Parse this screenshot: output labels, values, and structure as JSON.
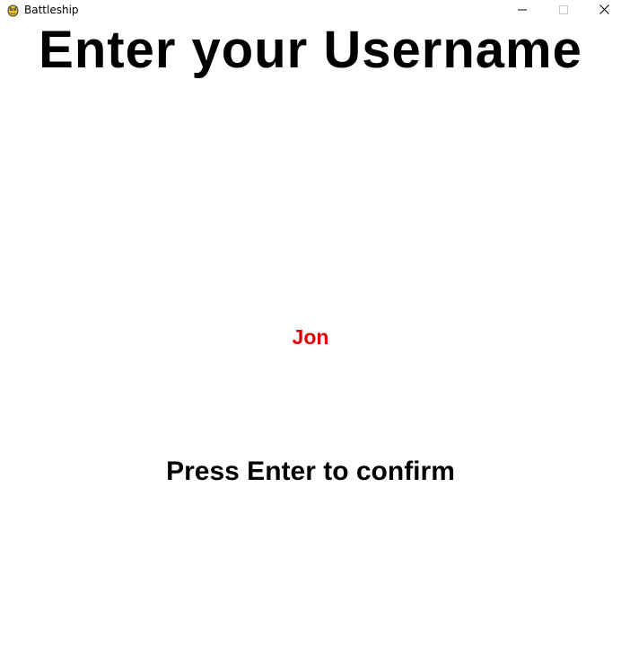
{
  "window": {
    "title": "Battleship",
    "icon": "pygame-snake-icon"
  },
  "screen": {
    "heading": "Enter your Username",
    "username_value": "Jon",
    "hint": "Press Enter to confirm"
  },
  "colors": {
    "background": "#ffffff",
    "heading": "#000000",
    "username": "#e00000",
    "hint": "#000000"
  }
}
